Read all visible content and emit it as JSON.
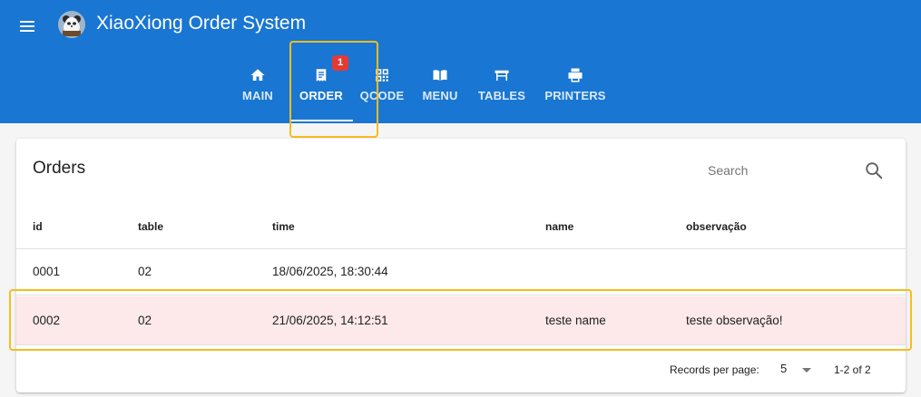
{
  "app": {
    "title": "XiaoXiong Order System"
  },
  "tabs": [
    {
      "label": "MAIN",
      "icon": "home-icon"
    },
    {
      "label": "ORDER",
      "icon": "receipt-icon",
      "badge": "1",
      "active": true
    },
    {
      "label": "QCODE",
      "icon": "qr-code-icon"
    },
    {
      "label": "MENU",
      "icon": "menu-book-icon"
    },
    {
      "label": "TABLES",
      "icon": "table-icon"
    },
    {
      "label": "PRINTERS",
      "icon": "printer-icon"
    }
  ],
  "orders": {
    "title": "Orders",
    "search_placeholder": "Search",
    "columns": [
      "id",
      "table",
      "time",
      "name",
      "observação"
    ],
    "rows": [
      {
        "id": "0001",
        "table": "02",
        "time": "18/06/2025, 18:30:44",
        "name": "",
        "observacao": ""
      },
      {
        "id": "0002",
        "table": "02",
        "time": "21/06/2025, 14:12:51",
        "name": "teste name",
        "observacao": "teste observação!"
      }
    ],
    "footer": {
      "records_per_page_label": "Records per page:",
      "records_per_page_value": "5",
      "range": "1-2 of 2"
    }
  },
  "colors": {
    "primary": "#1976d2",
    "highlight_row": "#fde8ea",
    "badge": "#e53935",
    "annotation": "#f5bd1f"
  }
}
